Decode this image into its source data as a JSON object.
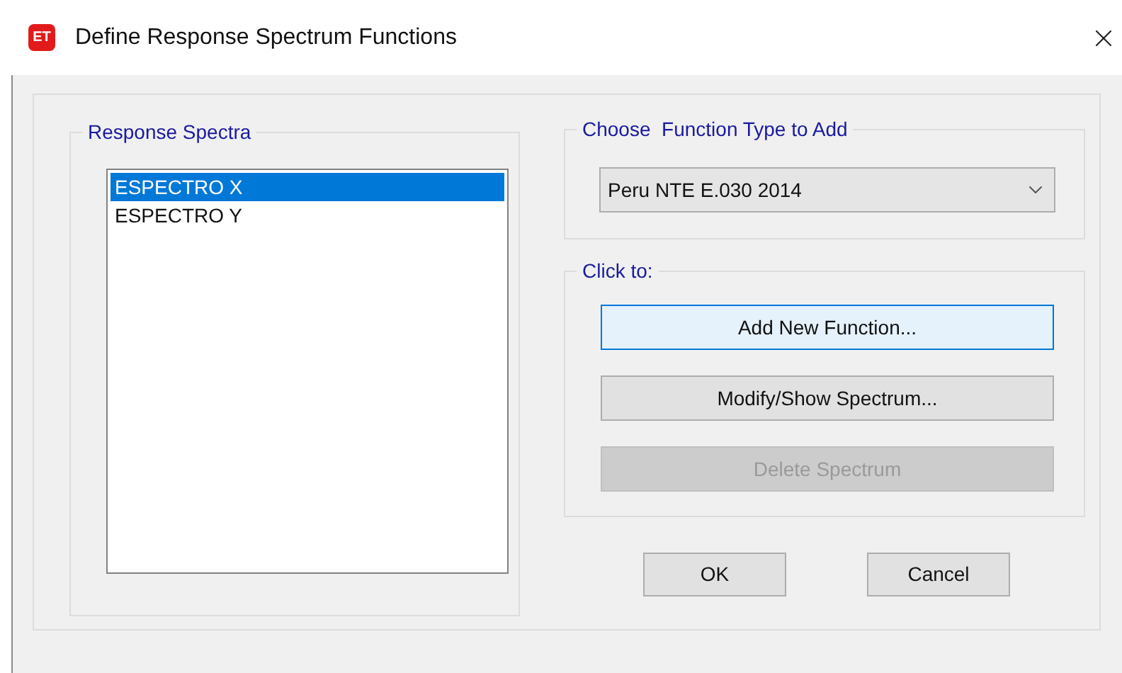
{
  "window": {
    "title": "Define Response Spectrum Functions",
    "icon_text": "ET"
  },
  "response_spectra": {
    "title": "Response Spectra",
    "items": [
      {
        "label": "ESPECTRO X",
        "selected": true
      },
      {
        "label": "ESPECTRO Y",
        "selected": false
      }
    ]
  },
  "function_type": {
    "title": "Choose  Function Type to Add",
    "value": "Peru NTE E.030 2014"
  },
  "click_to": {
    "title": "Click to:",
    "buttons": [
      {
        "label": "Add New Function...",
        "focused": true,
        "disabled": false
      },
      {
        "label": "Modify/Show Spectrum...",
        "focused": false,
        "disabled": false
      },
      {
        "label": "Delete Spectrum",
        "focused": false,
        "disabled": true
      }
    ]
  },
  "footer_buttons": [
    "OK",
    "Cancel"
  ]
}
